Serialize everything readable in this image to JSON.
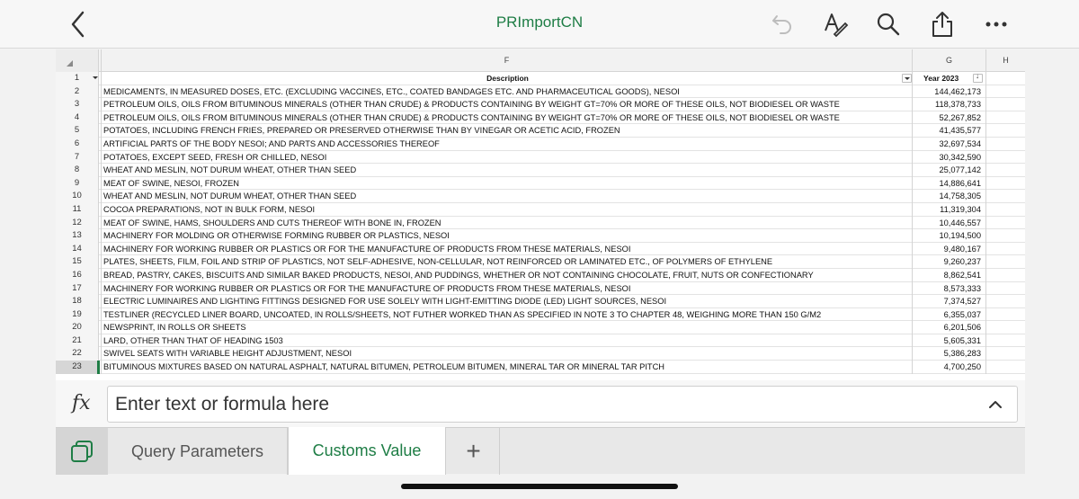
{
  "header": {
    "title": "PRImportCN",
    "icons": [
      "back-chevron-icon",
      "undo-icon",
      "text-format-icon",
      "search-icon",
      "share-icon",
      "more-icon"
    ]
  },
  "sheet": {
    "columns": {
      "corner": "",
      "f": "F",
      "g": "G",
      "h": "H"
    },
    "header_row": {
      "num": "1",
      "description": "Description",
      "value": "Year 2023"
    },
    "selected_row": "23",
    "rows": [
      {
        "num": "2",
        "description": "MEDICAMENTS, IN MEASURED DOSES, ETC. (EXCLUDING VACCINES, ETC., COATED BANDAGES ETC. AND PHARMACEUTICAL GOODS), NESOI",
        "value": "144,462,173"
      },
      {
        "num": "3",
        "description": "PETROLEUM OILS, OILS FROM BITUMINOUS MINERALS (OTHER THAN CRUDE) & PRODUCTS CONTAINING BY WEIGHT GT=70% OR MORE OF THESE OILS, NOT BIODIESEL OR WASTE",
        "value": "118,378,733"
      },
      {
        "num": "4",
        "description": "PETROLEUM OILS, OILS FROM BITUMINOUS MINERALS (OTHER THAN CRUDE) & PRODUCTS CONTAINING BY WEIGHT GT=70% OR MORE OF THESE OILS, NOT BIODIESEL OR WASTE",
        "value": "52,267,852"
      },
      {
        "num": "5",
        "description": "POTATOES, INCLUDING FRENCH FRIES, PREPARED OR PRESERVED OTHERWISE THAN BY VINEGAR OR ACETIC ACID, FROZEN",
        "value": "41,435,577"
      },
      {
        "num": "6",
        "description": "ARTIFICIAL PARTS OF THE BODY NESOI; AND PARTS AND ACCESSORIES THEREOF",
        "value": "32,697,534"
      },
      {
        "num": "7",
        "description": "POTATOES, EXCEPT SEED, FRESH OR CHILLED, NESOI",
        "value": "30,342,590"
      },
      {
        "num": "8",
        "description": "WHEAT AND MESLIN, NOT DURUM WHEAT, OTHER THAN SEED",
        "value": "25,077,142"
      },
      {
        "num": "9",
        "description": "MEAT OF SWINE, NESOI, FROZEN",
        "value": "14,886,641"
      },
      {
        "num": "10",
        "description": "WHEAT AND MESLIN, NOT DURUM WHEAT, OTHER THAN SEED",
        "value": "14,758,305"
      },
      {
        "num": "11",
        "description": "COCOA PREPARATIONS, NOT IN BULK FORM, NESOI",
        "value": "11,319,304"
      },
      {
        "num": "12",
        "description": "MEAT OF SWINE, HAMS, SHOULDERS AND CUTS THEREOF WITH BONE IN, FROZEN",
        "value": "10,446,557"
      },
      {
        "num": "13",
        "description": "MACHINERY FOR MOLDING OR OTHERWISE FORMING RUBBER OR PLASTICS, NESOI",
        "value": "10,194,500"
      },
      {
        "num": "14",
        "description": "MACHINERY FOR WORKING RUBBER OR PLASTICS OR FOR THE MANUFACTURE OF PRODUCTS FROM THESE MATERIALS, NESOI",
        "value": "9,480,167"
      },
      {
        "num": "15",
        "description": "PLATES, SHEETS, FILM, FOIL AND STRIP OF PLASTICS, NOT SELF-ADHESIVE, NON-CELLULAR, NOT REINFORCED OR LAMINATED ETC., OF POLYMERS OF ETHYLENE",
        "value": "9,260,237"
      },
      {
        "num": "16",
        "description": "BREAD, PASTRY, CAKES, BISCUITS AND SIMILAR BAKED PRODUCTS, NESOI, AND PUDDINGS, WHETHER OR NOT CONTAINING CHOCOLATE, FRUIT, NUTS OR CONFECTIONARY",
        "value": "8,862,541"
      },
      {
        "num": "17",
        "description": "MACHINERY FOR WORKING RUBBER OR PLASTICS OR FOR THE MANUFACTURE OF PRODUCTS FROM THESE MATERIALS, NESOI",
        "value": "8,573,333"
      },
      {
        "num": "18",
        "description": "ELECTRIC LUMINAIRES AND LIGHTING FITTINGS DESIGNED FOR USE SOLELY WITH LIGHT-EMITTING DIODE (LED) LIGHT SOURCES, NESOI",
        "value": "7,374,527"
      },
      {
        "num": "19",
        "description": "TESTLINER (RECYCLED LINER BOARD, UNCOATED, IN ROLLS/SHEETS, NOT FUTHER WORKED THAN AS SPECIFIED IN NOTE 3 TO CHAPTER 48, WEIGHING MORE THAN 150 G/M2",
        "value": "6,355,037"
      },
      {
        "num": "20",
        "description": "NEWSPRINT, IN ROLLS OR SHEETS",
        "value": "6,201,506"
      },
      {
        "num": "21",
        "description": "LARD, OTHER THAN THAT OF HEADING 1503",
        "value": "5,605,331"
      },
      {
        "num": "22",
        "description": "SWIVEL SEATS WITH VARIABLE HEIGHT ADJUSTMENT, NESOI",
        "value": "5,386,283"
      },
      {
        "num": "23",
        "description": "BITUMINOUS MIXTURES BASED ON NATURAL ASPHALT, NATURAL BITUMEN, PETROLEUM BITUMEN, MINERAL TAR OR MINERAL TAR PITCH",
        "value": "4,700,250"
      }
    ]
  },
  "formula_bar": {
    "fx_label": "fx",
    "placeholder": "Enter text or formula here"
  },
  "tabs": {
    "items": [
      {
        "label": "Query Parameters",
        "active": false
      },
      {
        "label": "Customs Value",
        "active": true
      }
    ],
    "add_label": "+"
  },
  "colors": {
    "accent": "#1e7d45"
  }
}
